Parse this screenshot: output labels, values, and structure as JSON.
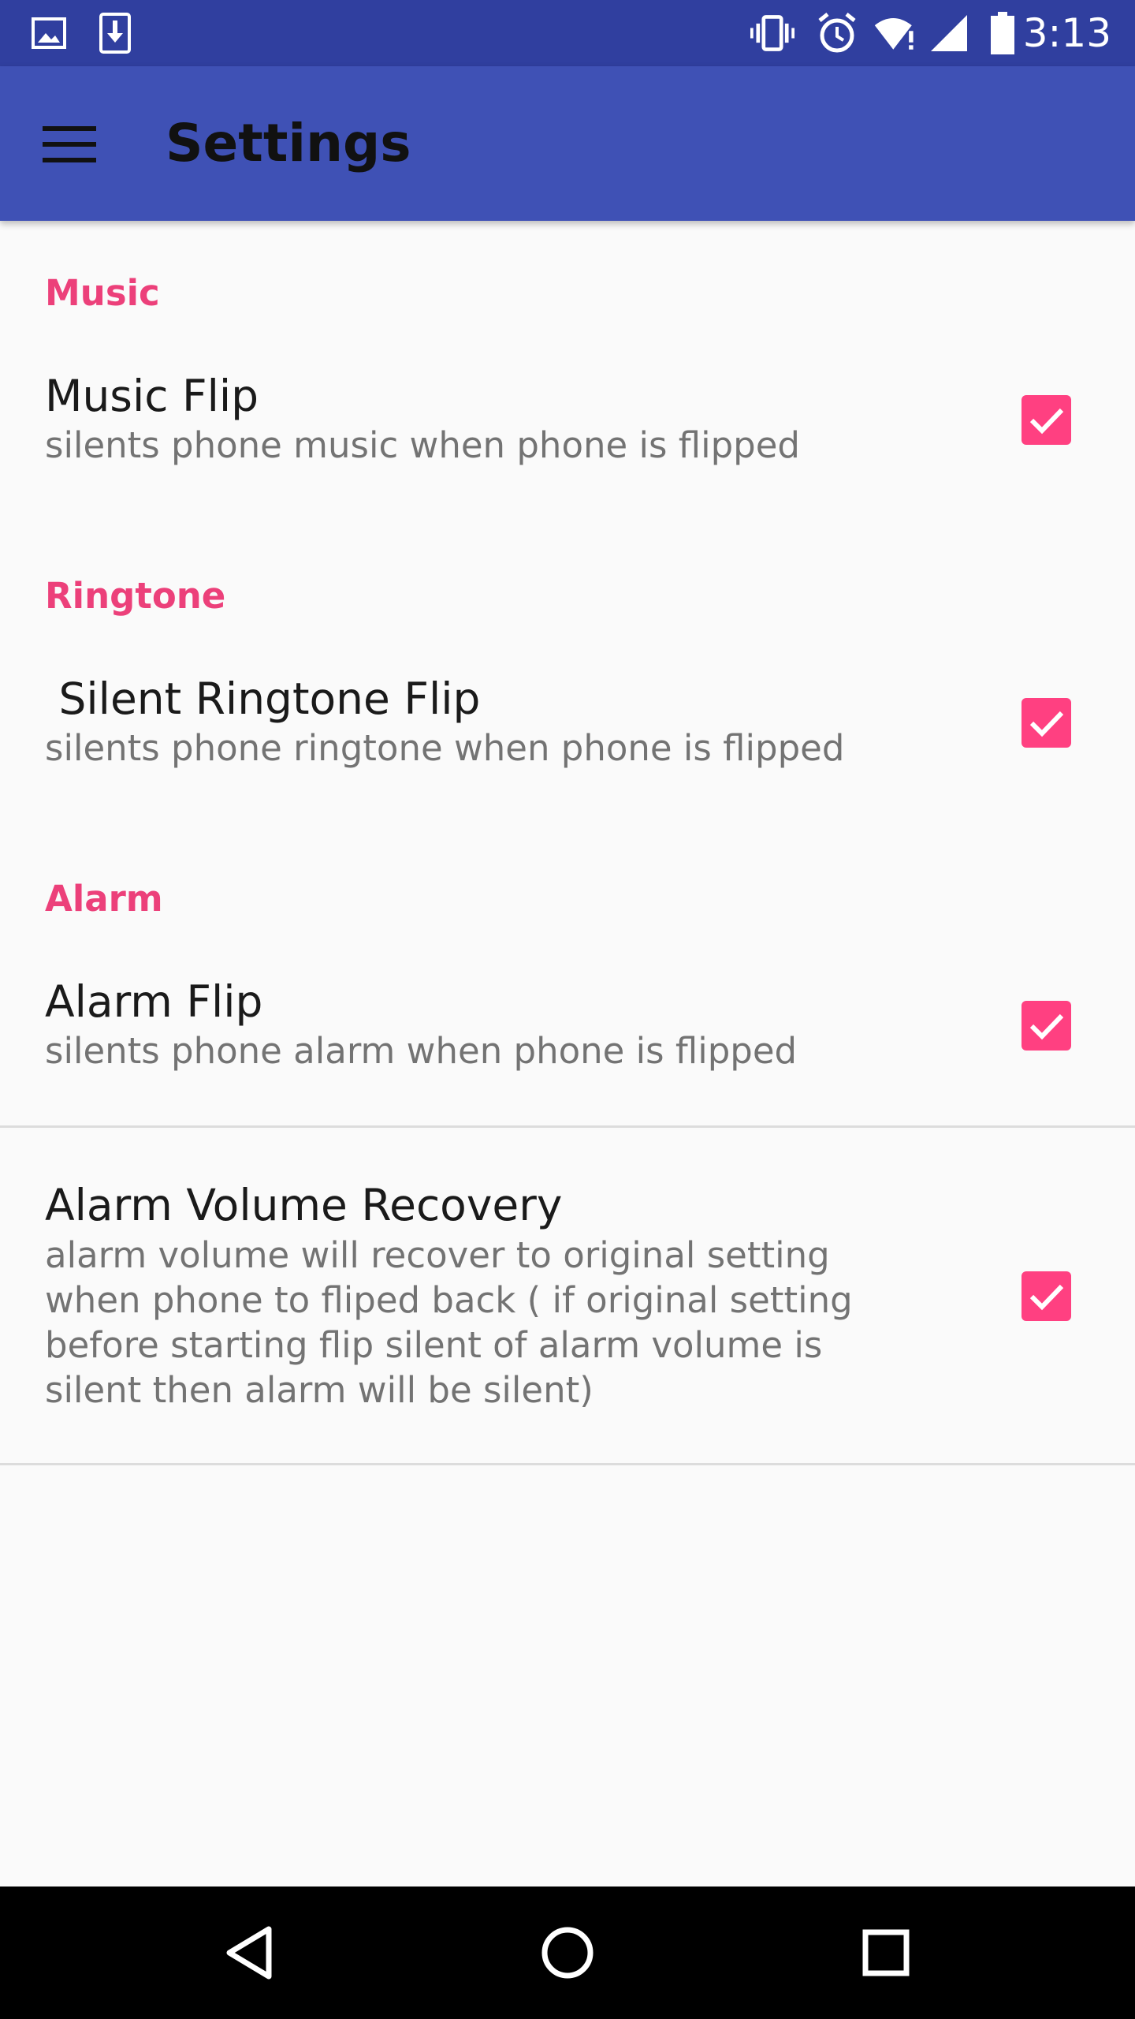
{
  "status_bar": {
    "time": "3:13",
    "left_icons": [
      "image-icon",
      "download-icon"
    ],
    "right_icons": [
      "vibrate-icon",
      "alarm-icon",
      "wifi-icon",
      "signal-icon",
      "battery-icon"
    ]
  },
  "app_bar": {
    "title": "Settings",
    "menu_icon": "hamburger-menu-icon",
    "background": "#3F51B5"
  },
  "colors": {
    "accent": "#FF4081",
    "category_text": "#EC407A",
    "status_bar": "#303F9F"
  },
  "sections": [
    {
      "category": "Music",
      "preferences": [
        {
          "title": "Music Flip",
          "summary": "silents phone music when phone is flipped",
          "checked": true
        }
      ]
    },
    {
      "category": "Ringtone",
      "preferences": [
        {
          "title": " Silent Ringtone Flip",
          "summary": "silents phone ringtone when phone is flipped",
          "checked": true
        }
      ]
    },
    {
      "category": "Alarm",
      "preferences": [
        {
          "title": "Alarm Flip",
          "summary": "silents phone alarm when phone is flipped",
          "checked": true
        },
        {
          "title": "Alarm Volume Recovery",
          "summary": "alarm volume will recover to original setting when phone to fliped back ( if original setting before starting flip silent of alarm volume is silent then alarm will be silent)",
          "checked": true
        }
      ]
    }
  ],
  "nav_bar": {
    "buttons": [
      "back-icon",
      "home-icon",
      "recents-icon"
    ]
  }
}
